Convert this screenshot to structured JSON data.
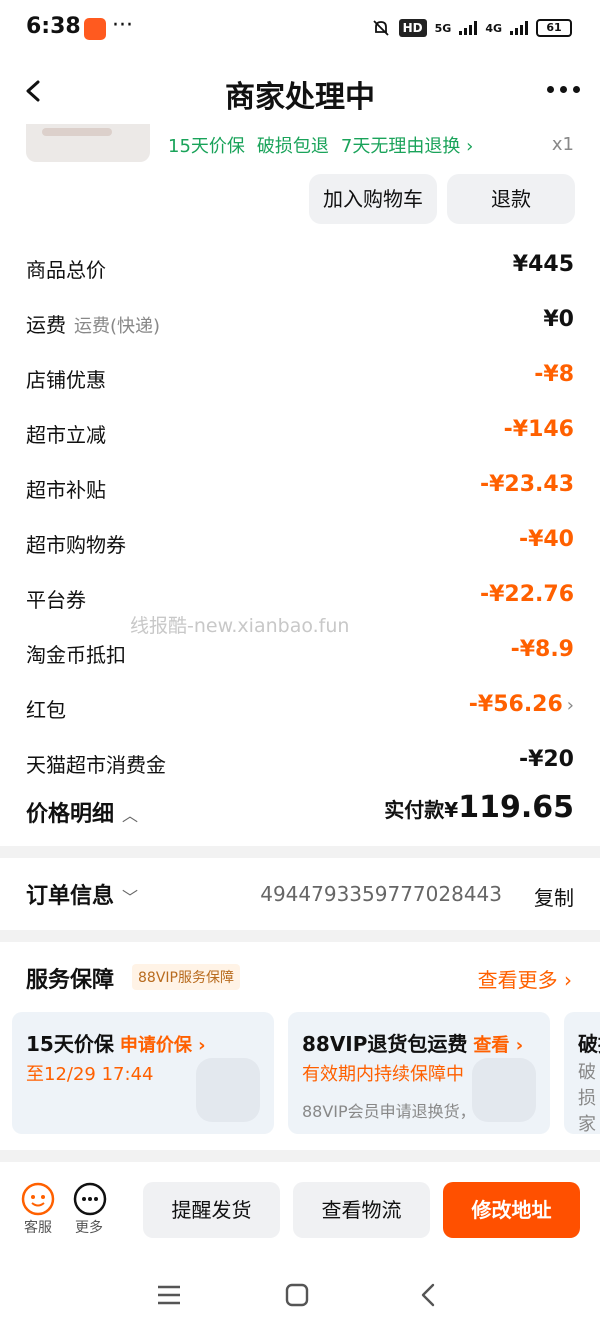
{
  "status_bar": {
    "time": "6:38",
    "app_icon": "taobao-icon",
    "network": {
      "hd": "HD",
      "sig1": "5G",
      "sig2": "4G"
    },
    "battery": "61"
  },
  "header": {
    "title": "商家处理中",
    "back_icon": "back-arrow-icon",
    "more_icon": "more-dots-icon"
  },
  "product": {
    "guarantees": [
      "15天价保",
      "破损包退",
      "7天无理由退换 ›"
    ],
    "quantity": "x1",
    "add_to_cart_label": "加入购物车",
    "refund_label": "退款"
  },
  "price_rows": [
    {
      "label": "商品总价",
      "sub": "",
      "value": "¥445",
      "highlight": false,
      "arrow": ""
    },
    {
      "label": "运费",
      "sub": "运费(快递)",
      "value": "¥0",
      "highlight": false,
      "arrow": ""
    },
    {
      "label": "店铺优惠",
      "sub": "",
      "value": "-¥8",
      "highlight": true,
      "arrow": ""
    },
    {
      "label": "超市立减",
      "sub": "",
      "value": "-¥146",
      "highlight": true,
      "arrow": ""
    },
    {
      "label": "超市补贴",
      "sub": "",
      "value": "-¥23.43",
      "highlight": true,
      "arrow": ""
    },
    {
      "label": "超市购物券",
      "sub": "",
      "value": "-¥40",
      "highlight": true,
      "arrow": ""
    },
    {
      "label": "平台券",
      "sub": "",
      "value": "-¥22.76",
      "highlight": true,
      "arrow": ""
    },
    {
      "label": "淘金币抵扣",
      "sub": "",
      "value": "-¥8.9",
      "highlight": true,
      "arrow": ""
    },
    {
      "label": "红包",
      "sub": "",
      "value": "-¥56.26",
      "highlight": true,
      "arrow": "›"
    },
    {
      "label": "天猫超市消费金",
      "sub": "",
      "value": "-¥20",
      "highlight": false,
      "arrow": ""
    }
  ],
  "price_detail": {
    "label": "价格明细",
    "chevron": "︿",
    "actual_label": "实付款¥",
    "actual_value": "119.65"
  },
  "watermark": "线报酷-new.xianbao.fun",
  "order_info": {
    "label": "订单信息",
    "chevron": "﹀",
    "order_number": "4944793359777028443",
    "copy_label": "复制"
  },
  "service": {
    "title": "服务保障",
    "badge": "88VIP服务保障",
    "see_more": "查看更多 ›",
    "cards": [
      {
        "title": "15天价保",
        "action": "申请价保 ›",
        "line2": "至12/29 17:44",
        "line3": ""
      },
      {
        "title": "88VIP退货包运费",
        "action": "查看 ›",
        "line2": "有效期内持续保障中",
        "line3": "88VIP会员申请退换货，..."
      },
      {
        "title": "破损",
        "action": "",
        "line2": "",
        "line3": "破损家承"
      }
    ]
  },
  "bottom_bar": {
    "customer_service": "客服",
    "more": "更多",
    "remind_ship": "提醒发货",
    "view_logistics": "查看物流",
    "change_address": "修改地址"
  },
  "colors": {
    "accent": "#ff6000",
    "green": "#1aa35a",
    "primary_button": "#ff5000"
  }
}
